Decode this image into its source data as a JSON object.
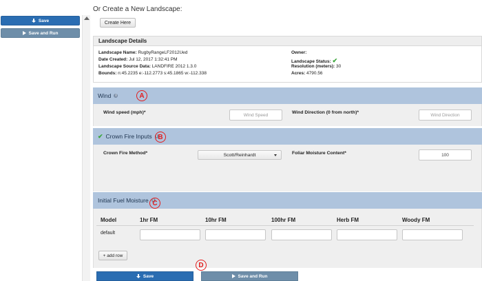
{
  "sidebar": {
    "save_label": "Save",
    "save_run_label": "Save and Run"
  },
  "create": {
    "title": "Or Create a New Landscape:",
    "button": "Create Here"
  },
  "details": {
    "header": "Landscape Details",
    "name_label": "Landscape Name:",
    "name_value": "RugbyRangeLF2012Ued",
    "date_label": "Date Created:",
    "date_value": "Jul 12, 2017 1:32:41 PM",
    "source_label": "Landscape Source Data:",
    "source_value": "LANDFIRE 2012 1.3.0",
    "bounds_label": "Bounds:",
    "bounds_value": "n:45.2235 e:-112.2773 s:45.1865 w:-112.338",
    "owner_label": "Owner:",
    "status_label": "Landscape Status:",
    "resolution_label": "Resolution (meters):",
    "resolution_value": "30",
    "acres_label": "Acres:",
    "acres_value": "4790.56"
  },
  "wind": {
    "header": "Wind",
    "speed_label": "Wind speed (mph)*",
    "speed_placeholder": "Wind Speed",
    "direction_label": "Wind Direction (0 from north)*",
    "direction_placeholder": "Wind Direction"
  },
  "crown": {
    "header": "Crown Fire Inputs",
    "method_label": "Crown Fire Method*",
    "method_value": "Scott/Reinhardt",
    "foliar_label": "Foliar Moisture Content*",
    "foliar_value": "100"
  },
  "fuel": {
    "header": "Initial Fuel Moisture",
    "columns": [
      "Model",
      "1hr FM",
      "10hr FM",
      "100hr FM",
      "Herb FM",
      "Woody FM"
    ],
    "row_model": "default",
    "add_row": "+ add row"
  },
  "bottom": {
    "save_label": "Save",
    "save_run_label": "Save and Run"
  },
  "markers": {
    "a": "A",
    "b": "B",
    "c": "C",
    "d": "D"
  },
  "icons": {
    "info": "info-circle-icon",
    "check": "check-icon",
    "save": "download-icon",
    "run": "play-icon"
  },
  "colors": {
    "primary": "#2a6db2",
    "secondary": "#6e8ea9",
    "section_header": "#afc4dd",
    "annotation": "#e31c1c",
    "success": "#3aa53a"
  }
}
